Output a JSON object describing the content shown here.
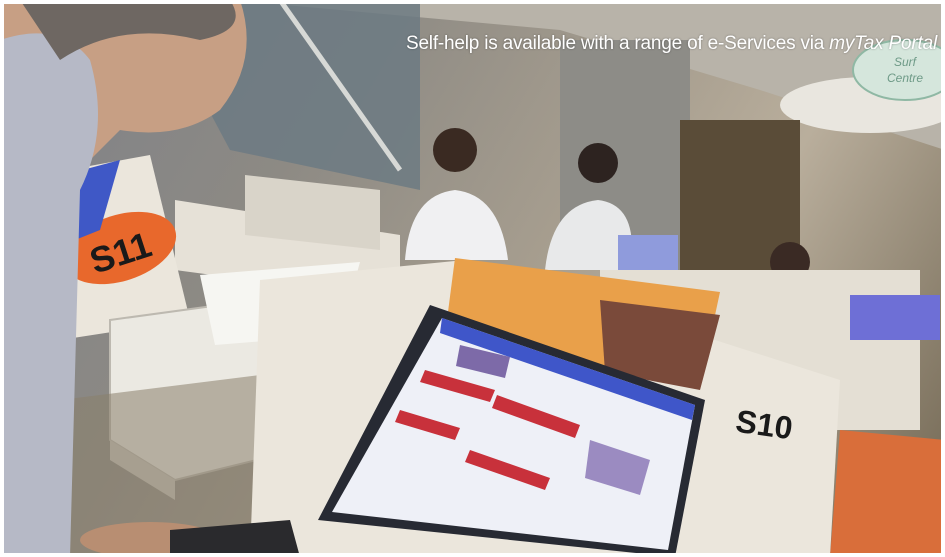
{
  "caption": {
    "text": "Self-help is available with a range of e-Services via ",
    "emphasis": "myTax Portal"
  },
  "scene": {
    "kiosk_labels": [
      "S11",
      "S10"
    ],
    "sign_text": [
      "Surf",
      "Centre"
    ]
  },
  "colors": {
    "kiosk_shell": "#e9e4da",
    "accent_orange": "#e8682c",
    "screen_blue": "#3f56c9",
    "web_red": "#c8313b",
    "web_purple": "#9b8bc1",
    "banner_orange": "#e9a04a"
  }
}
